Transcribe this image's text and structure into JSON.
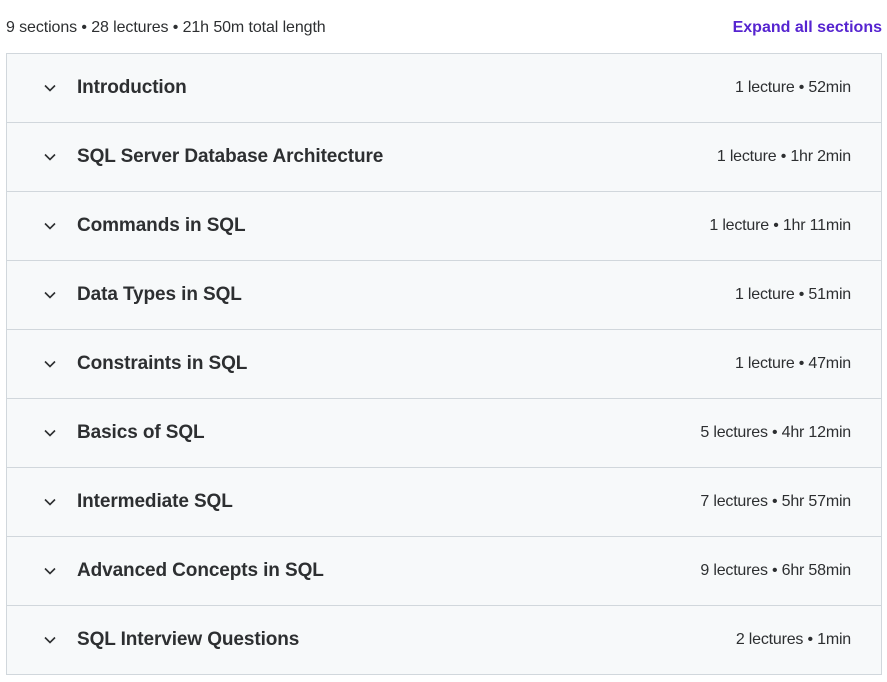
{
  "header": {
    "summary": "9 sections • 28 lectures • 21h 50m total length",
    "expand_label": "Expand all sections"
  },
  "colors": {
    "accent": "#5624d0",
    "row_bg": "#f7f9fa",
    "border": "#d1d7dc",
    "text": "#2d2f31"
  },
  "sections": [
    {
      "title": "Introduction",
      "meta": "1 lecture • 52min"
    },
    {
      "title": "SQL Server Database Architecture",
      "meta": "1 lecture • 1hr 2min"
    },
    {
      "title": "Commands in SQL",
      "meta": "1 lecture • 1hr 11min"
    },
    {
      "title": "Data Types in SQL",
      "meta": "1 lecture • 51min"
    },
    {
      "title": "Constraints in SQL",
      "meta": "1 lecture • 47min"
    },
    {
      "title": "Basics of SQL",
      "meta": "5 lectures • 4hr 12min"
    },
    {
      "title": "Intermediate SQL",
      "meta": "7 lectures • 5hr 57min"
    },
    {
      "title": "Advanced Concepts in SQL",
      "meta": "9 lectures • 6hr 58min"
    },
    {
      "title": "SQL Interview Questions",
      "meta": "2 lectures • 1min"
    }
  ],
  "icons": {
    "section_toggle": "chevron-down-icon"
  }
}
